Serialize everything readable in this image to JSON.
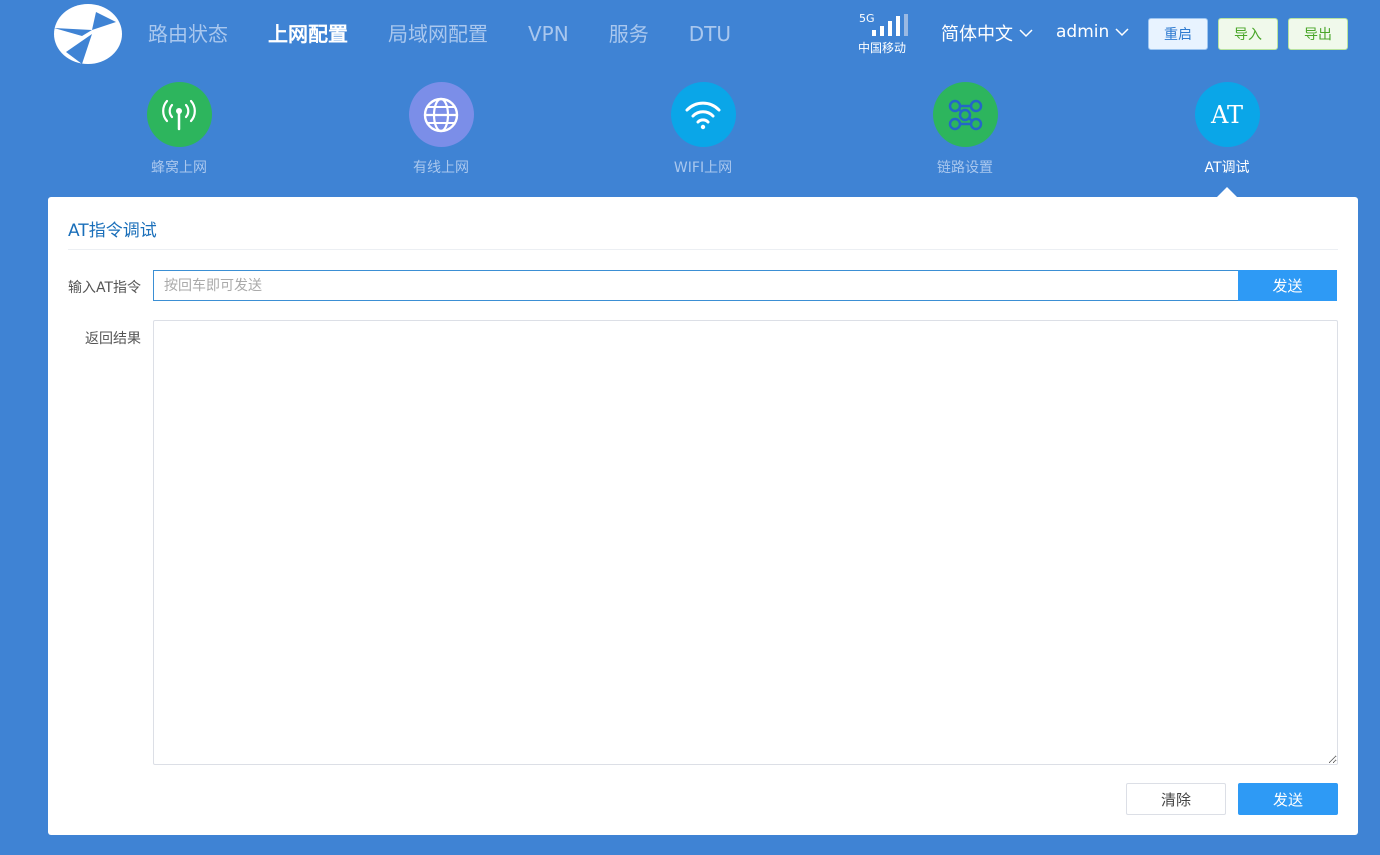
{
  "topbar": {
    "nav": [
      {
        "label": "路由状态",
        "active": false
      },
      {
        "label": "上网配置",
        "active": true
      },
      {
        "label": "局域网配置",
        "active": false
      },
      {
        "label": "VPN",
        "active": false
      },
      {
        "label": "服务",
        "active": false
      },
      {
        "label": "DTU",
        "active": false
      }
    ],
    "signal": {
      "generation": "5G",
      "carrier": "中国移动",
      "bars": 4
    },
    "language": "简体中文",
    "user": "admin",
    "buttons": {
      "restart": "重启",
      "import": "导入",
      "export": "导出"
    }
  },
  "subnav": [
    {
      "label": "蜂窝上网",
      "icon": "antenna-icon",
      "color": "#2db55d",
      "active": false
    },
    {
      "label": "有线上网",
      "icon": "globe-icon",
      "color": "#7b8ee8",
      "active": false
    },
    {
      "label": "WIFI上网",
      "icon": "wifi-icon",
      "color": "#0aa6e8",
      "active": false
    },
    {
      "label": "链路设置",
      "icon": "link-nodes-icon",
      "color": "#2db55d",
      "active": false
    },
    {
      "label": "AT调试",
      "icon": "at-icon",
      "icon_text": "AT",
      "color": "#0aa6e8",
      "active": true
    }
  ],
  "panel": {
    "title": "AT指令调试",
    "input_label": "输入AT指令",
    "input_placeholder": "按回车即可发送",
    "input_value": "",
    "send_inline": "发送",
    "result_label": "返回结果",
    "result_value": "",
    "clear_button": "清除",
    "send_button": "发送"
  },
  "colors": {
    "background": "#3f83d4",
    "primary": "#2e9af5",
    "title": "#1a6fba"
  }
}
